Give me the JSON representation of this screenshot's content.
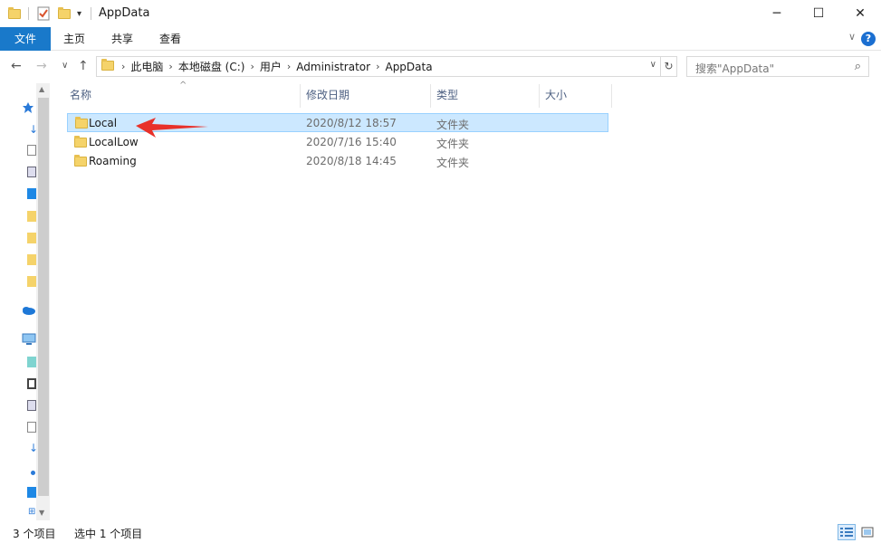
{
  "window": {
    "title": "AppData",
    "minimize_glyph": "─",
    "maximize_glyph": "☐",
    "close_glyph": "✕"
  },
  "ribbon": {
    "tabs": [
      "文件",
      "主页",
      "共享",
      "查看"
    ],
    "help_glyph": "?",
    "collapse_glyph": "∨"
  },
  "address": {
    "crumbs": [
      "此电脑",
      "本地磁盘 (C:)",
      "用户",
      "Administrator",
      "AppData"
    ],
    "search_placeholder": "搜索\"AppData\""
  },
  "columns": {
    "name": "名称",
    "modified": "修改日期",
    "type": "类型",
    "size": "大小"
  },
  "files": [
    {
      "name": "Local",
      "modified": "2020/8/12 18:57",
      "type": "文件夹",
      "size": "",
      "selected": true
    },
    {
      "name": "LocalLow",
      "modified": "2020/7/16 15:40",
      "type": "文件夹",
      "size": "",
      "selected": false
    },
    {
      "name": "Roaming",
      "modified": "2020/8/18 14:45",
      "type": "文件夹",
      "size": "",
      "selected": false
    }
  ],
  "status": {
    "item_count": "3 个项目",
    "selected_count": "选中 1 个项目"
  },
  "colors": {
    "file_tab": "#1979ca",
    "selection_bg": "#cce8ff",
    "selection_border": "#99d1ff",
    "annotation_arrow": "#e8312a"
  }
}
